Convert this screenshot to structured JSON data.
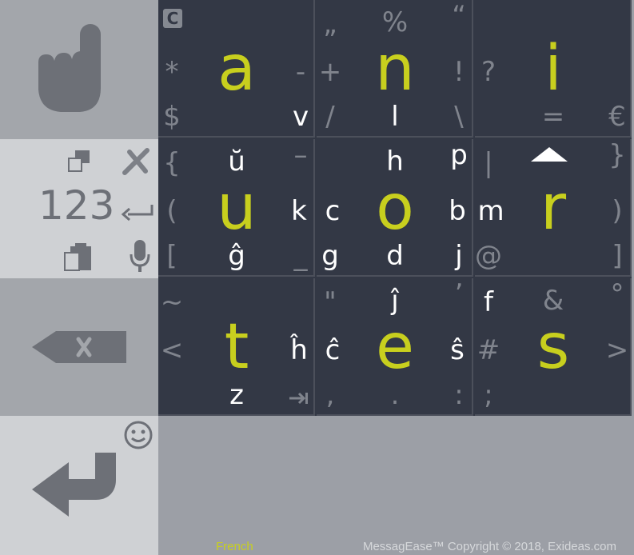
{
  "keyboard": {
    "cells": [
      {
        "id": "top-left",
        "main": "a",
        "chars": {
          "tl": "C",
          "l": "*",
          "r": "-",
          "bl": "$",
          "br": "v"
        }
      },
      {
        "id": "top-center",
        "main": "n",
        "chars": {
          "tl": "„",
          "t": "%",
          "tr": "“",
          "l": "+",
          "r": "!",
          "bl": "/",
          "b": "l",
          "br": "\\"
        }
      },
      {
        "id": "top-right",
        "main": "i",
        "chars": {
          "l": "?",
          "b": "=",
          "br": "€"
        }
      },
      {
        "id": "mid-left",
        "main": "u",
        "chars": {
          "tl": "{",
          "t": "ŭ",
          "tr": "–",
          "l": "(",
          "r": "k",
          "bl": "[",
          "b": "ĝ",
          "br": "_"
        }
      },
      {
        "id": "mid-center",
        "main": "o",
        "chars": {
          "t": "h",
          "tr": "p",
          "l": "c",
          "r": "b",
          "bl": "g",
          "b": "d",
          "br": "j"
        }
      },
      {
        "id": "mid-right",
        "main": "r",
        "chars": {
          "tl": "|",
          "tr": "}",
          "l": "m",
          "r": ")",
          "bl": "@",
          "br": "]"
        }
      },
      {
        "id": "bot-left",
        "main": "t",
        "chars": {
          "tl": "~",
          "l": "<",
          "r": "ĥ",
          "b": "z"
        }
      },
      {
        "id": "bot-center",
        "main": "e",
        "chars": {
          "tl": "\"",
          "t": "ĵ",
          "tr": "’",
          "l": "ĉ",
          "r": "ŝ",
          "bl": ",",
          "b": ".",
          "br": ":"
        }
      },
      {
        "id": "bot-right",
        "main": "s",
        "chars": {
          "tl": "f",
          "t": "&",
          "tr": "°",
          "l": "#",
          "r": ">",
          "bl": ";"
        }
      }
    ]
  },
  "side": {
    "num_label": "123"
  },
  "footer": {
    "language": "French",
    "copyright": "MessagEase™ Copyright © 2018, Exideas.com"
  },
  "colors": {
    "main_letter": "#c8cf1e",
    "grid_bg": "#333845",
    "panel_gray": "#a3a6ab",
    "panel_light": "#cfd1d4"
  },
  "icons": [
    "hand-pointer-icon",
    "copy-icon",
    "close-x-icon",
    "return-arrow-icon",
    "paste-clipboard-icon",
    "microphone-icon",
    "backspace-icon",
    "smiley-icon",
    "enter-icon",
    "tab-arrow-icon",
    "caret-up-icon"
  ]
}
